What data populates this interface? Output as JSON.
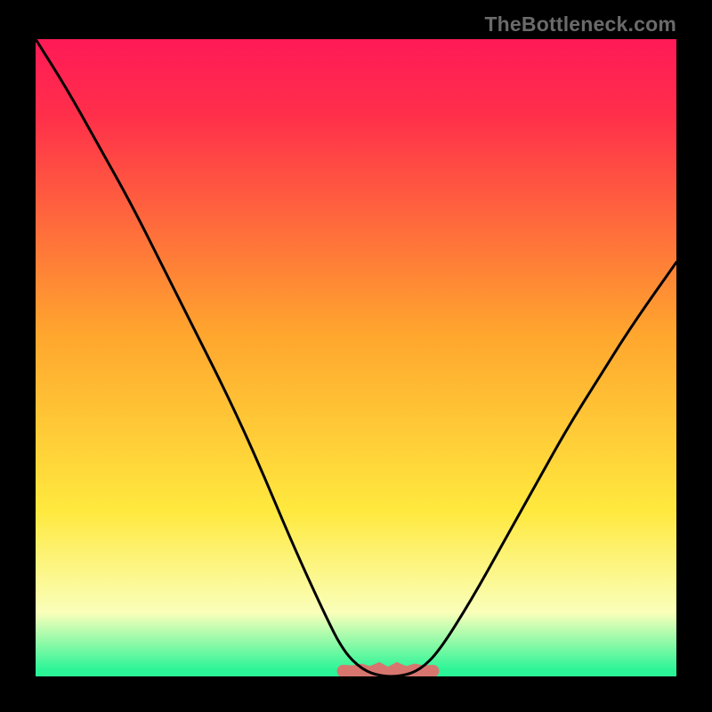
{
  "watermark": "TheBottleneck.com",
  "colors": {
    "top": "#ff1a57",
    "red": "#ff2f4a",
    "orange": "#ffa52e",
    "yellow": "#ffe93e",
    "pale": "#faffba",
    "green": "#2bf597",
    "curve": "#000000",
    "blob": "#d7766f"
  },
  "chart_data": {
    "type": "line",
    "title": "",
    "xlabel": "",
    "ylabel": "",
    "xlim": [
      0,
      100
    ],
    "ylim": [
      0,
      100
    ],
    "series": [
      {
        "name": "bottleneck-curve",
        "x": [
          0,
          5,
          10,
          15,
          20,
          25,
          30,
          35,
          40,
          45,
          48,
          51,
          54,
          57,
          60,
          63,
          68,
          73,
          78,
          83,
          88,
          93,
          100
        ],
        "values": [
          100,
          92,
          83,
          74,
          64,
          54,
          44,
          33,
          21,
          10,
          4,
          1,
          0,
          0,
          1,
          4,
          12,
          21,
          30,
          39,
          47,
          55,
          65
        ]
      }
    ],
    "annotations": [
      {
        "name": "floor-blob",
        "x_range": [
          48,
          62
        ],
        "y": 0
      }
    ]
  }
}
